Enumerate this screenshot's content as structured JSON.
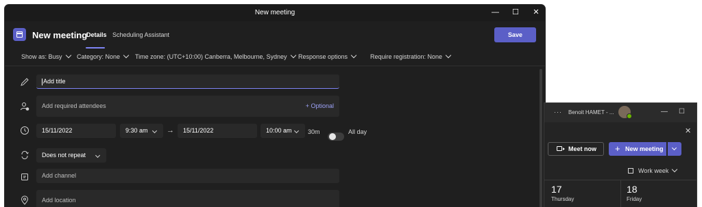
{
  "window": {
    "title": "New meeting",
    "controls": {
      "minimize": "—",
      "maximize": "☐",
      "close": "✕"
    }
  },
  "header": {
    "title": "New meeting",
    "tabs": [
      {
        "label": "Details",
        "active": true
      },
      {
        "label": "Scheduling Assistant",
        "active": false
      }
    ],
    "save_label": "Save",
    "accent": "#5b5fc7"
  },
  "options": {
    "show_as": "Show as: Busy",
    "category": "Category: None",
    "time_zone": "Time zone: (UTC+10:00) Canberra, Melbourne, Sydney",
    "response": "Response options",
    "registration": "Require registration: None"
  },
  "form": {
    "title_placeholder": "Add title",
    "attendees_placeholder": "Add required attendees",
    "optional_link": "+ Optional",
    "start_date": "15/11/2022",
    "start_time": "9:30 am",
    "end_date": "15/11/2022",
    "end_time": "10:00 am",
    "duration": "30m",
    "all_day_label": "All day",
    "all_day_on": false,
    "repeat": "Does not repeat",
    "channel_placeholder": "Add channel",
    "location_placeholder": "Add location",
    "arrow": "→"
  },
  "calendar_window": {
    "user": "Benoit HAMET - ...",
    "more": "···",
    "meet_now": "Meet now",
    "new_meeting": "New meeting",
    "view": "Work week",
    "days": [
      {
        "num": "17",
        "name": "Thursday"
      },
      {
        "num": "18",
        "name": "Friday"
      }
    ]
  }
}
